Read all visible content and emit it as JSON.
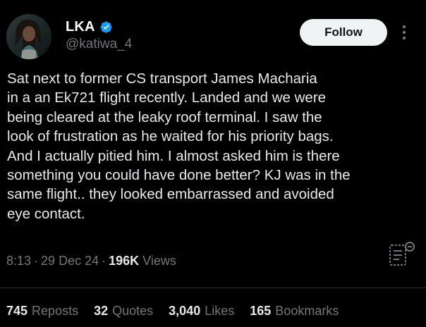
{
  "user": {
    "display_name": "LKA",
    "handle": "@katiwa_4",
    "verified_color": "#1d9bf0"
  },
  "actions": {
    "follow_label": "Follow"
  },
  "tweet": {
    "text": "Sat next to  former CS transport James Macharia\nin a  an Ek721 flight recently.  Landed and we were\nbeing cleared at the leaky roof terminal.  I saw the\nlook of frustration as he waited for his priority bags.\nAnd I actually pitied him. I almost asked him is there\nsomething you could have done better? KJ was in the\nsame flight.. they looked embarrassed and avoided\neye contact."
  },
  "meta": {
    "time": "8:13",
    "separator": "·",
    "date": "29 Dec 24",
    "views_count": "196K",
    "views_label": "Views"
  },
  "stats": [
    {
      "count": "745",
      "label": "Reposts"
    },
    {
      "count": "32",
      "label": "Quotes"
    },
    {
      "count": "3,040",
      "label": "Likes"
    },
    {
      "count": "165",
      "label": "Bookmarks"
    }
  ],
  "icons": {
    "verified": "verified-badge-icon",
    "more": "more-dots-icon",
    "article": "article-icon"
  }
}
